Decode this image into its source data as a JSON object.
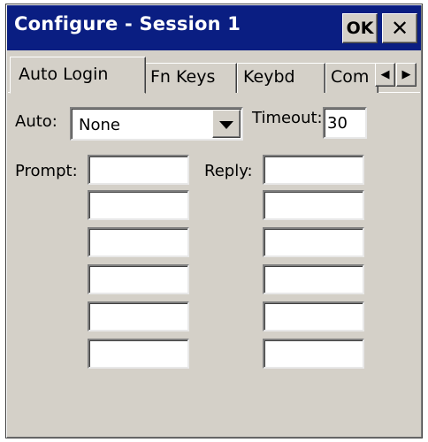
{
  "window": {
    "title": "Configure - Session 1",
    "ok_label": "OK",
    "close_label": "✕"
  },
  "tabs": [
    {
      "label": "Auto Login",
      "active": true
    },
    {
      "label": "Fn Keys",
      "active": false
    },
    {
      "label": "Keybd",
      "active": false
    },
    {
      "label": "Com",
      "active": false
    }
  ],
  "tab_scroll": {
    "left_icon": "◀",
    "right_icon": "▶"
  },
  "auto_login": {
    "auto_label": "Auto:",
    "auto_value": "None",
    "timeout_label": "Timeout:",
    "timeout_value": "30",
    "prompt_label": "Prompt:",
    "reply_label": "Reply:",
    "prompts": [
      "",
      "",
      "",
      "",
      "",
      ""
    ],
    "replies": [
      "",
      "",
      "",
      "",
      "",
      ""
    ]
  },
  "colors": {
    "titlebar": "#0a1e82",
    "face": "#d4d0c8"
  }
}
